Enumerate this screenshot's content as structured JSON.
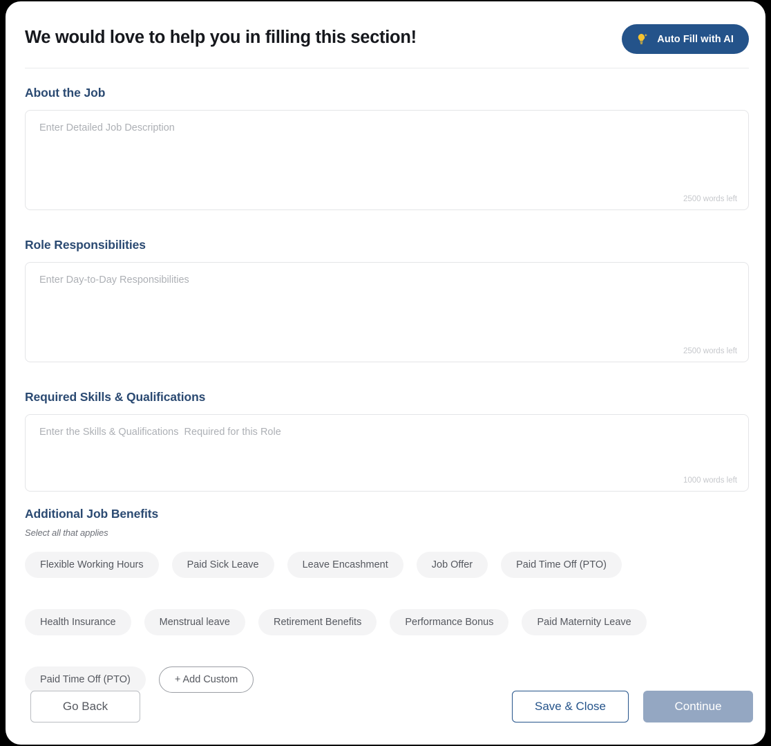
{
  "header": {
    "title": "We would love to help you in filling this section!",
    "autofill_button": {
      "label": "Auto Fill with AI",
      "icon": "lightbulb-sparkle-icon",
      "bg_color": "#24538a",
      "icon_color": "#f5c330",
      "text_color": "#ffffff"
    }
  },
  "sections": [
    {
      "key": "about_the_job",
      "title": "About the Job",
      "placeholder": "Enter Detailed Job Description",
      "value": "",
      "word_count": "2500 words left"
    },
    {
      "key": "role_responsibilities",
      "title": "Role Responsibilities",
      "placeholder": "Enter Day-to-Day Responsibilities",
      "value": "",
      "word_count": "2500 words left"
    },
    {
      "key": "required_skills",
      "title": "Required Skills & Qualifications",
      "placeholder": "Enter the Skills & Qualifications  Required for this Role",
      "value": "",
      "word_count": "1000 words left"
    }
  ],
  "benefits": {
    "title": "Additional Job Benefits",
    "subtitle": "Select all that applies",
    "rows": [
      [
        "Flexible Working Hours",
        "Paid Sick Leave",
        "Leave Encashment",
        "Job Offer",
        "Paid Time Off (PTO)"
      ],
      [
        "Health Insurance",
        "Menstrual leave",
        "Retirement Benefits",
        "Performance Bonus",
        "Paid Maternity Leave"
      ],
      [
        "Paid Time Off (PTO)"
      ]
    ],
    "add_custom_label": "+ Add Custom",
    "chip_bg_color": "#f4f4f5",
    "chip_text_color": "#55585f"
  },
  "footer": {
    "go_back_label": "Go Back",
    "save_close_label": "Save & Close",
    "continue_label": "Continue",
    "continue_bg_color": "#94a7c2",
    "save_border_color": "#24538a"
  }
}
